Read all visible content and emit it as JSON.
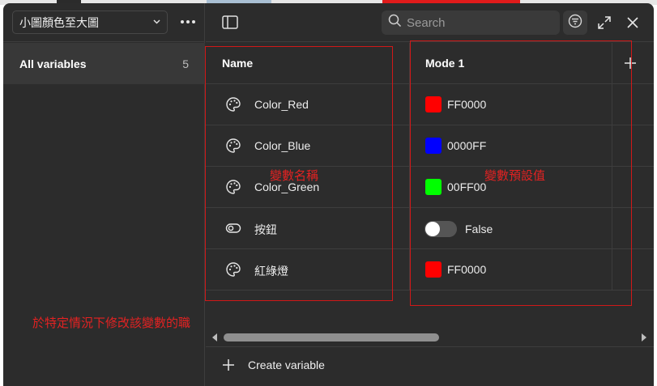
{
  "sidebar": {
    "collection_name": "小圖顏色至大圖",
    "all_variables_label": "All variables",
    "all_variables_count": "5"
  },
  "toolbar": {
    "search_placeholder": "Search"
  },
  "table": {
    "name_header": "Name",
    "mode_header": "Mode 1",
    "rows": [
      {
        "type": "color",
        "name": "Color_Red",
        "value": "FF0000",
        "color": "#ff0000"
      },
      {
        "type": "color",
        "name": "Color_Blue",
        "value": "0000FF",
        "color": "#0000ff"
      },
      {
        "type": "color",
        "name": "Color_Green",
        "value": "00FF00",
        "color": "#00ff00"
      },
      {
        "type": "boolean",
        "name": "按鈕",
        "value": "False"
      },
      {
        "type": "color",
        "name": "紅綠燈",
        "value": "FF0000",
        "color": "#ff0000"
      }
    ]
  },
  "footer": {
    "create_label": "Create variable"
  },
  "annotations": {
    "name_column": "變數名稱",
    "default_value_column": "變數預設值",
    "note": "於特定情況下修改該變數的職"
  },
  "colors": {
    "background": "#2c2c2c",
    "annotation_red": "#d01818"
  }
}
